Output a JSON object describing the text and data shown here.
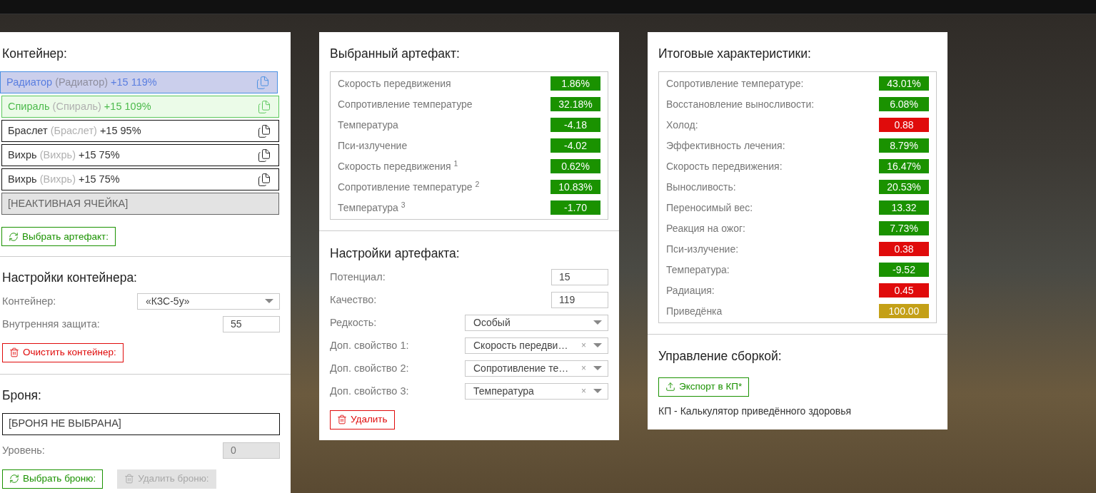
{
  "container": {
    "title": "Контейнер:",
    "slots": [
      {
        "kind": "active",
        "name": "Радиатор",
        "alt": "(Радиатор)",
        "stats": "+15 119%"
      },
      {
        "kind": "matched",
        "name": "Спираль",
        "alt": "(Спираль)",
        "stats": "+15 109%"
      },
      {
        "kind": "normal",
        "name": "Браслет",
        "alt": "(Браслет)",
        "stats": "+15 95%"
      },
      {
        "kind": "normal",
        "name": "Вихрь",
        "alt": "(Вихрь)",
        "stats": "+15 75%"
      },
      {
        "kind": "normal",
        "name": "Вихрь",
        "alt": "(Вихрь)",
        "stats": "+15 75%"
      },
      {
        "kind": "empty",
        "name": "[НЕАКТИВНАЯ ЯЧЕЙКА]"
      }
    ],
    "button": {
      "label": "Выбрать артефакт:",
      "kind": "select",
      "disabled": false
    }
  },
  "container_settings": {
    "title": "Настройки контейнера:",
    "fields": [
      {
        "kind": "select",
        "label": "Контейнер:",
        "value": "«КЗС-5у»"
      },
      {
        "kind": "number",
        "label": "Внутренняя защита:",
        "value": "55",
        "disabled": false
      }
    ],
    "button": {
      "label": "Очистить контейнер:",
      "kind": "delete",
      "disabled": false
    }
  },
  "armor": {
    "title": "Броня:",
    "slot": "[БРОНЯ НЕ ВЫБРАНА]",
    "fields": [
      {
        "kind": "number",
        "label": "Уровень:",
        "value": "0",
        "disabled": true
      }
    ],
    "buttons": [
      {
        "label": "Выбрать броню:",
        "kind": "select",
        "disabled": false
      },
      {
        "label": "Удалить броню:",
        "kind": "delete",
        "disabled": true
      }
    ]
  },
  "selected_artifact": {
    "title": "Выбранный артефакт:",
    "stats": [
      {
        "label": "Скорость передвижения",
        "value": "1.86%",
        "color": "#1a9200"
      },
      {
        "label": "Сопротивление температуре",
        "value": "32.18%",
        "color": "#1a9200"
      },
      {
        "label": "Температура",
        "value": "-4.18",
        "color": "#1a9200"
      },
      {
        "label": "Пси-излучение",
        "value": "-4.02",
        "color": "#1a9200"
      },
      {
        "label": "Скорость передвижения $^{1}$",
        "value": "0.62%",
        "color": "#1a9200"
      },
      {
        "label": "Сопротивление температуре $^{2}$",
        "value": "10.83%",
        "color": "#1a9200"
      },
      {
        "label": "Температура $^{3}$",
        "value": "-1.70",
        "color": "#1a9200"
      }
    ]
  },
  "artifact_settings": {
    "title": "Настройки артефакта:",
    "fields": [
      {
        "kind": "number",
        "label": "Потенциал:",
        "value": "15",
        "disabled": false
      },
      {
        "kind": "number",
        "label": "Качество:",
        "value": "119",
        "disabled": false
      },
      {
        "kind": "select",
        "label": "Редкость:",
        "value": "Особый"
      },
      {
        "kind": "select",
        "label": "Доп. свойство 1:",
        "value": "Скорость передви…",
        "clear": "×"
      },
      {
        "kind": "select",
        "label": "Доп. свойство 2:",
        "value": "Сопротивление те…",
        "clear": "×"
      },
      {
        "kind": "select",
        "label": "Доп. свойство 3:",
        "value": "Температура",
        "clear": "×"
      }
    ],
    "button": {
      "label": "Удалить",
      "kind": "delete",
      "disabled": false
    }
  },
  "totals": {
    "title": "Итоговые характеристики:",
    "stats": [
      {
        "label": "Сопротивление температуре:",
        "value": "43.01%",
        "color": "#1a9200"
      },
      {
        "label": "Восстановление выносливости:",
        "value": "6.08%",
        "color": "#1a9200"
      },
      {
        "label": "Холод:",
        "value": "0.88",
        "color": "#e00b0b"
      },
      {
        "label": "Эффективность лечения:",
        "value": "8.79%",
        "color": "#1a9200"
      },
      {
        "label": "Скорость передвижения:",
        "value": "16.47%",
        "color": "#1a9200"
      },
      {
        "label": "Выносливость:",
        "value": "20.53%",
        "color": "#1a9200"
      },
      {
        "label": "Переносимый вес:",
        "value": "13.32",
        "color": "#1a9200"
      },
      {
        "label": "Реакция на ожог:",
        "value": "7.73%",
        "color": "#1a9200"
      },
      {
        "label": "Пси-излучение:",
        "value": "0.38",
        "color": "#e00b0b"
      },
      {
        "label": "Температура:",
        "value": "-9.52",
        "color": "#1a9200"
      },
      {
        "label": "Радиация:",
        "value": "0.45",
        "color": "#e00b0b"
      },
      {
        "label": "Приведёнка",
        "value": "100.00",
        "color": "#c4a017"
      }
    ]
  },
  "build": {
    "title": "Управление сборкой:",
    "button": {
      "label": "Экспорт в КП*",
      "kind": "export",
      "disabled": false
    },
    "note": "КП - Калькулятор приведённого здоровья"
  }
}
